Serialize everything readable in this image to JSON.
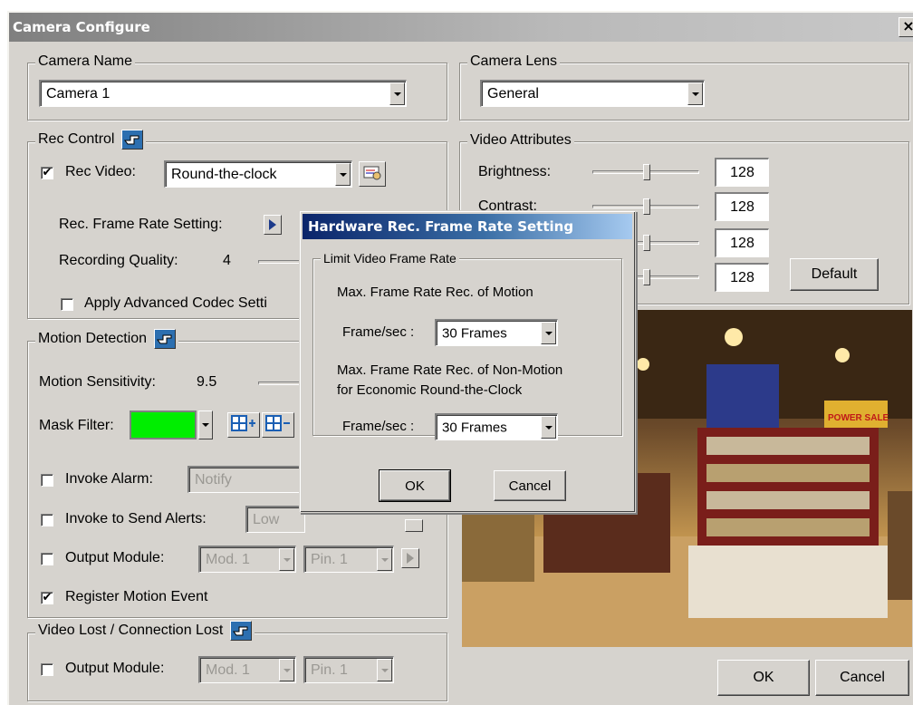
{
  "window": {
    "title": "Camera Configure",
    "close_glyph": "×"
  },
  "camera_name": {
    "label": "Camera Name",
    "value": "Camera 1"
  },
  "camera_lens": {
    "label": "Camera Lens",
    "value": "General"
  },
  "rec_control": {
    "label": "Rec Control",
    "rec_video_label": "Rec Video:",
    "rec_video_checked": true,
    "rec_video_value": "Round-the-clock",
    "frame_rate_label": "Rec. Frame Rate Setting:",
    "quality_label": "Recording Quality:",
    "quality_value": "4",
    "codec_label": "Apply Advanced Codec Setti"
  },
  "motion": {
    "label": "Motion Detection",
    "sensitivity_label": "Motion Sensitivity:",
    "sensitivity_value": "9.5",
    "mask_label": "Mask Filter:",
    "mask_color": "#00ee00",
    "invoke_alarm_label": "Invoke Alarm:",
    "invoke_alarm_value": "Notify",
    "send_alerts_label": "Invoke to Send Alerts:",
    "send_alerts_value": "Low",
    "output_label": "Output Module:",
    "output_mod": "Mod. 1",
    "output_pin": "Pin. 1",
    "register_label": "Register Motion Event",
    "register_checked": true
  },
  "video_lost": {
    "label": "Video Lost / Connection Lost",
    "output_label": "Output Module:",
    "output_mod": "Mod. 1",
    "output_pin": "Pin. 1"
  },
  "video_attributes": {
    "label": "Video Attributes",
    "rows": [
      {
        "label": "Brightness:",
        "value": "128"
      },
      {
        "label": "Contrast:",
        "value": "128"
      },
      {
        "label": "",
        "value": "128"
      },
      {
        "label": "",
        "value": "128"
      }
    ],
    "default_label": "Default"
  },
  "footer": {
    "ok": "OK",
    "cancel": "Cancel"
  },
  "dialog": {
    "title": "Hardware Rec. Frame Rate Setting",
    "group_label": "Limit Video Frame Rate",
    "motion_heading": "Max. Frame Rate Rec. of Motion",
    "motion_fps_label": "Frame/sec :",
    "motion_fps_value": "30 Frames",
    "nonmotion_heading_1": "Max. Frame Rate Rec. of Non-Motion",
    "nonmotion_heading_2": "for Economic Round-the-Clock",
    "nonmotion_fps_label": "Frame/sec :",
    "nonmotion_fps_value": "30 Frames",
    "ok": "OK",
    "cancel": "Cancel"
  },
  "preview_sign": "POWER SALE"
}
